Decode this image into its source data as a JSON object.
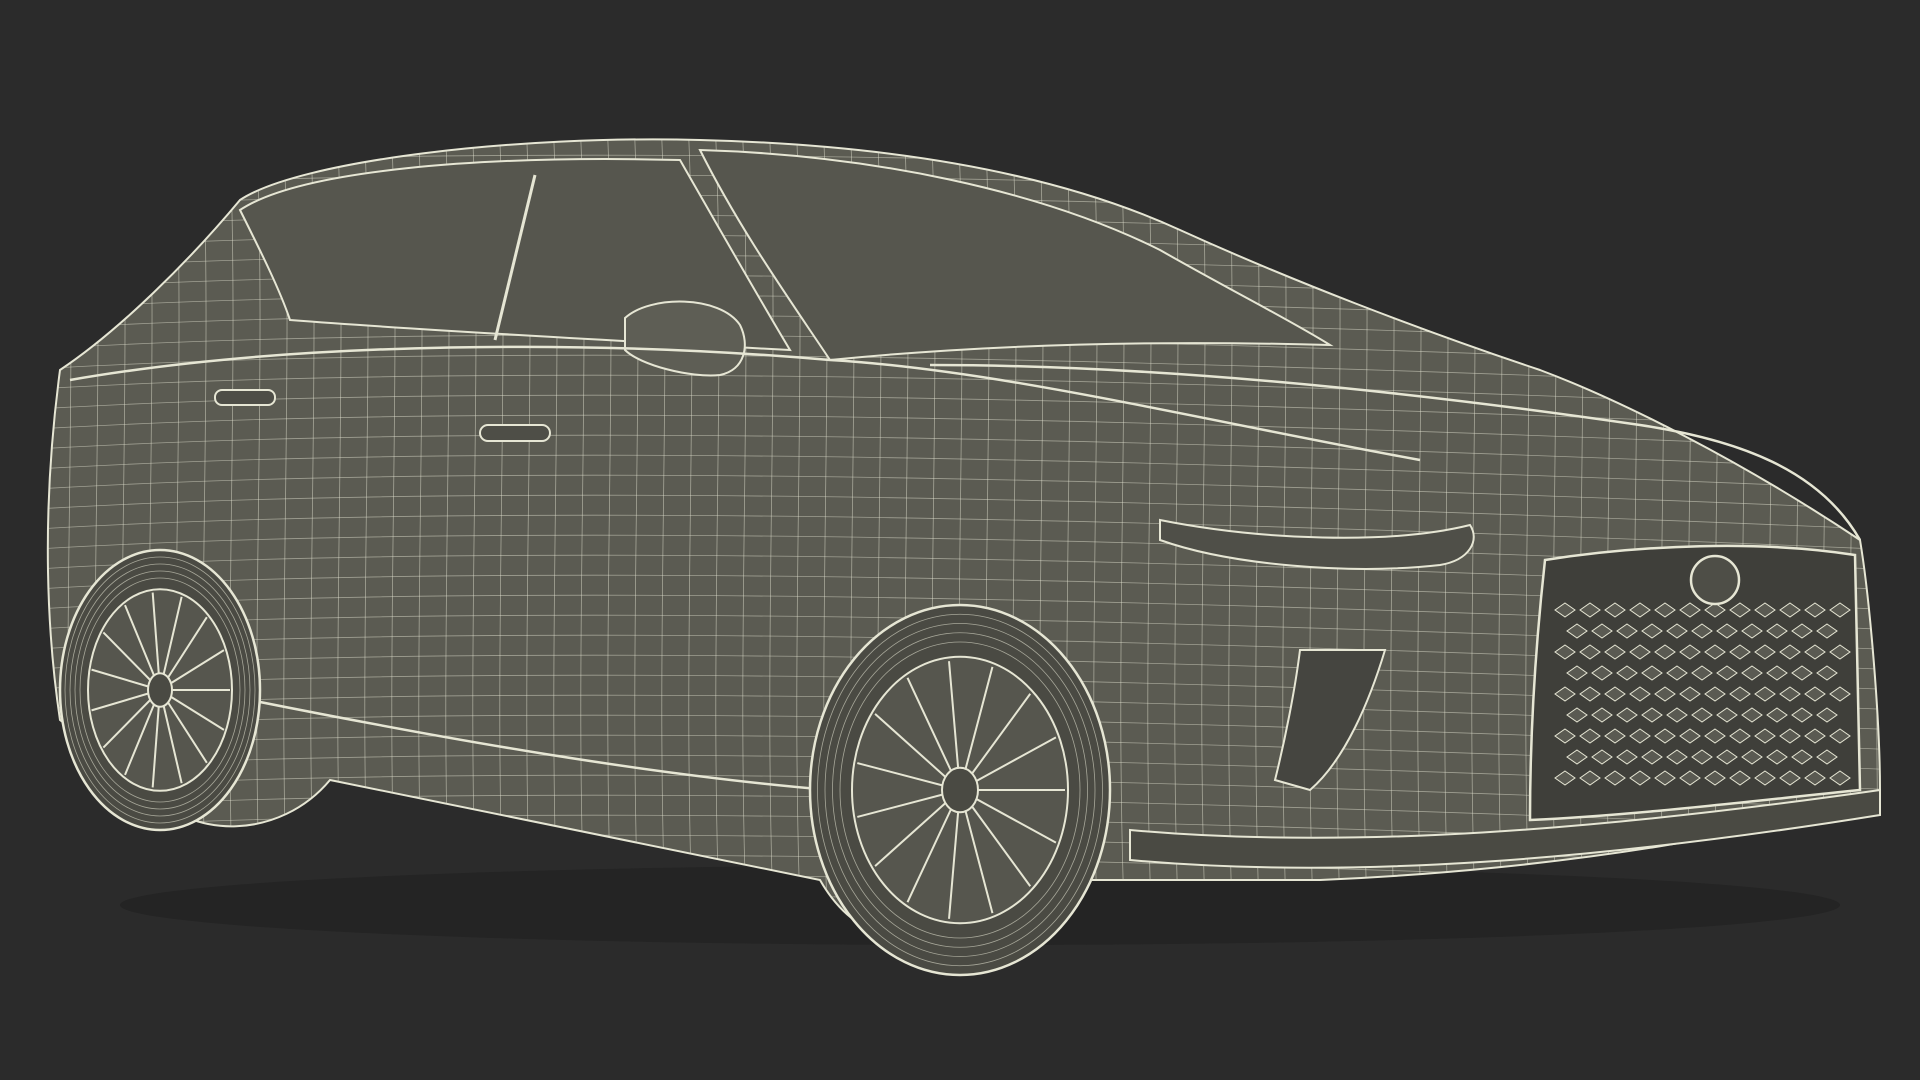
{
  "scene": {
    "subject": "suv-wireframe-render",
    "colors": {
      "background": "#2b2b2b",
      "mesh_fill": "#5b5b52",
      "mesh_fill_dark": "#4a4a43",
      "wire": "#e6e6d4",
      "wire_soft": "#c9c9b8"
    }
  }
}
